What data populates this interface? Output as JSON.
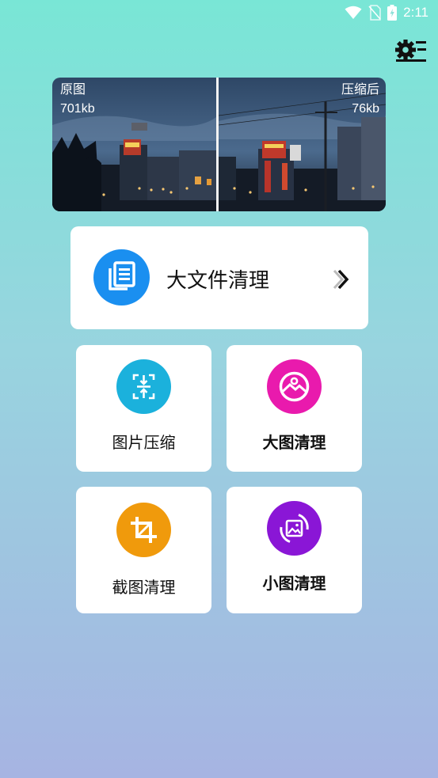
{
  "status_bar": {
    "time": "2:11",
    "icons": [
      "wifi-icon",
      "no-sim-icon",
      "battery-charging-icon"
    ]
  },
  "header": {
    "settings_icon": "settings-gear-list-icon"
  },
  "preview": {
    "original_label": "原图",
    "original_size": "701kb",
    "compressed_label": "压缩后",
    "compressed_size": "76kb"
  },
  "big_file": {
    "label": "大文件清理",
    "icon": "document-list-icon",
    "icon_color": "#1a8ff0"
  },
  "tiles": [
    {
      "label": "图片压缩",
      "icon": "compress-icon",
      "color": "#1bb1dc"
    },
    {
      "label": "大图清理",
      "icon": "image-circle-icon",
      "color": "#e91aad"
    },
    {
      "label": "截图清理",
      "icon": "crop-icon",
      "color": "#f09a0c"
    },
    {
      "label": "小图清理",
      "icon": "small-image-rotate-icon",
      "color": "#8a16d6"
    }
  ]
}
